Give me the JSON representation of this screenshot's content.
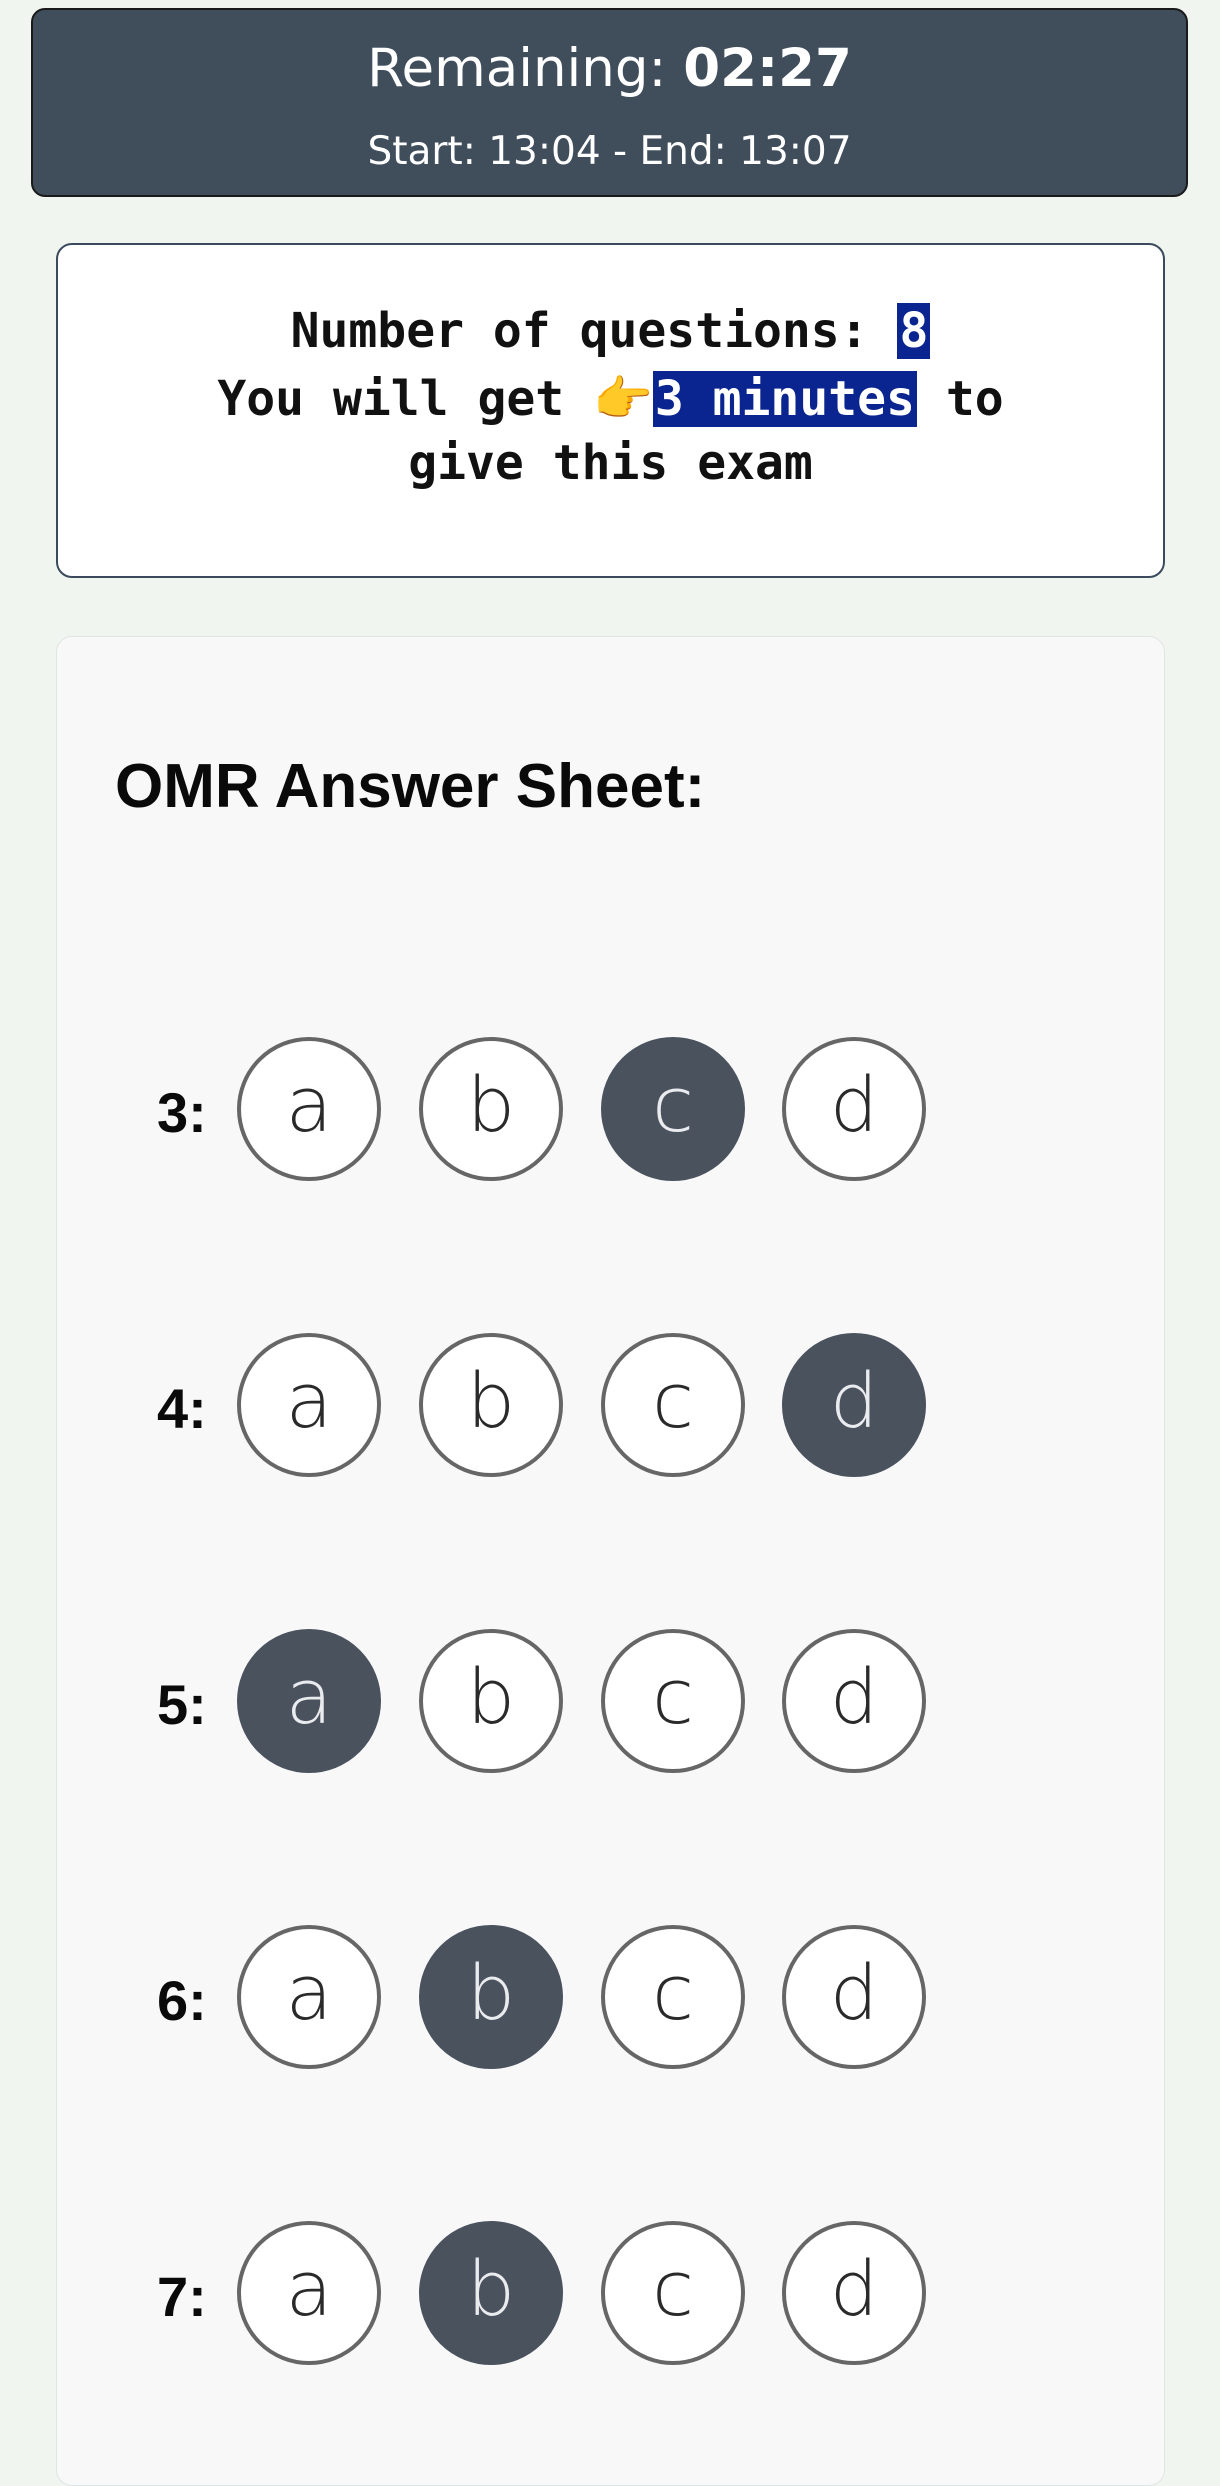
{
  "timer": {
    "label": "Remaining: ",
    "time": "02:27",
    "schedule": "Start: 13:04 - End: 13:07"
  },
  "info": {
    "questions_label": "Number of questions: ",
    "questions_count": "8",
    "line2_prefix": "You will get ",
    "pointer_emoji": "👉",
    "duration": "3 minutes",
    "line2_suffix": " to",
    "line3": "give this exam"
  },
  "sheet": {
    "title": "OMR Answer Sheet:",
    "questions": [
      {
        "number": "3:",
        "options": [
          "a",
          "b",
          "c",
          "d"
        ],
        "selected": "c"
      },
      {
        "number": "4:",
        "options": [
          "a",
          "b",
          "c",
          "d"
        ],
        "selected": "d"
      },
      {
        "number": "5:",
        "options": [
          "a",
          "b",
          "c",
          "d"
        ],
        "selected": "a"
      },
      {
        "number": "6:",
        "options": [
          "a",
          "b",
          "c",
          "d"
        ],
        "selected": "b"
      },
      {
        "number": "7:",
        "options": [
          "a",
          "b",
          "c",
          "d"
        ],
        "selected": "b"
      }
    ]
  },
  "colors": {
    "timer_bg": "#404e5c",
    "highlight": "#0a2590",
    "filled_bubble": "#4a525e",
    "page_bg": "#f1f5f0"
  }
}
